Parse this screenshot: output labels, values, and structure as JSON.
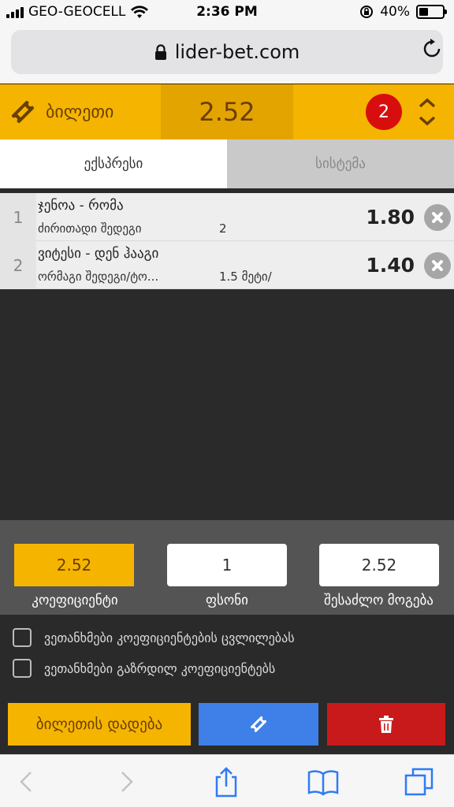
{
  "status_bar": {
    "carrier": "GEO-GEOCELL",
    "time": "2:36 PM",
    "battery": "40%"
  },
  "browser": {
    "url": "lider-bet.com"
  },
  "ticket": {
    "label": "ბილეთი",
    "total_odds": "2.52",
    "bet_count": "2"
  },
  "tabs": [
    {
      "label": "ექსპრესი",
      "active": true
    },
    {
      "label": "სისტემა",
      "active": false
    }
  ],
  "bets": [
    {
      "num": "1",
      "match": "ჯენოა - რომა",
      "market": "ძირითადი შედეგი",
      "outcome": "2",
      "odds": "1.80"
    },
    {
      "num": "2",
      "match": "ვიტესი - დენ ჰააგი",
      "market": "ორმაგი შედეგი/ტო...",
      "outcome": "1.5 მეტი/",
      "odds": "1.40"
    }
  ],
  "calculator": {
    "odds_value": "2.52",
    "stake_value": "1",
    "win_value": "2.52",
    "odds_label": "კოეფიციენტი",
    "stake_label": "ფსონი",
    "win_label": "შესაძლო მოგება"
  },
  "agreements": [
    "ვეთანხმები კოეფიციენტების ცვლილებას",
    "ვეთანხმები გაზრდილ კოეფიციენტებს"
  ],
  "actions": {
    "place_label": "ბილეთის დადება"
  },
  "colors": {
    "accent": "#f5b400",
    "accent_dark": "#e4a400",
    "danger": "#c81a1a",
    "share": "#3f7fe8"
  }
}
